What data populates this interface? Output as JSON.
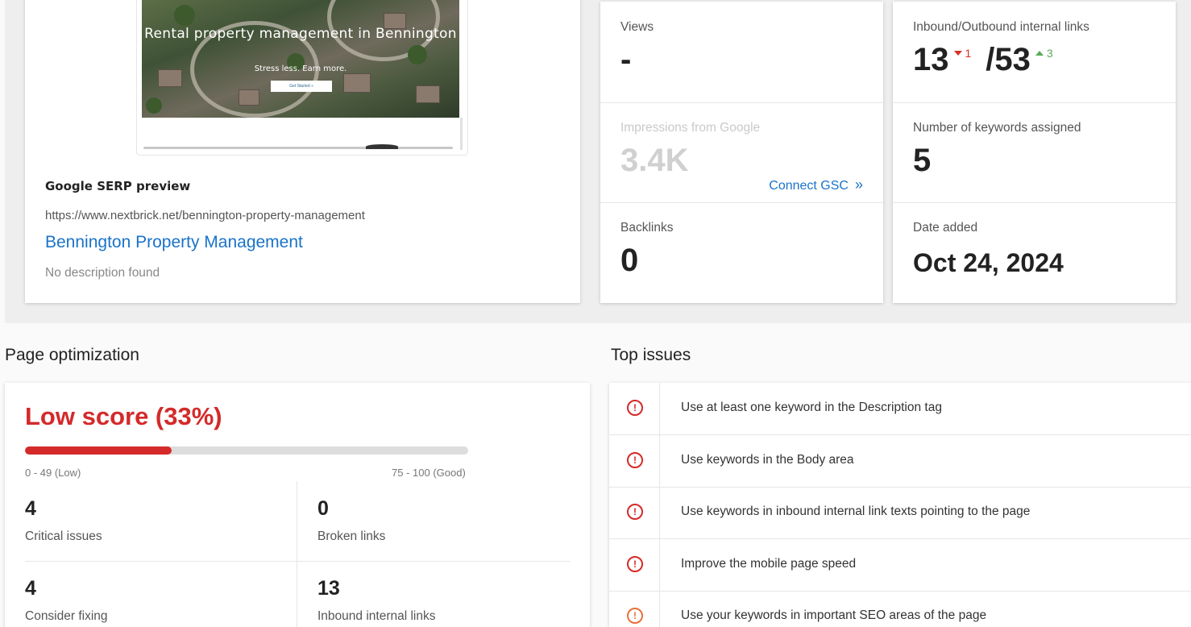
{
  "preview": {
    "thumbnail_title": "Rental property management in Bennington",
    "thumbnail_subtitle": "Stress less. Earn more.",
    "thumbnail_button": "Get Started »",
    "serp_heading": "Google SERP preview",
    "serp_url": "https://www.nextbrick.net/bennington-property-management",
    "serp_title": "Bennington Property Management",
    "serp_description": "No description found"
  },
  "metrics": {
    "views": {
      "label": "Views",
      "value": "-"
    },
    "impressions": {
      "label": "Impressions from Google",
      "value": "3.4K",
      "link": "Connect GSC",
      "link_icon": "»"
    },
    "backlinks": {
      "label": "Backlinks",
      "value": "0"
    },
    "internal_links": {
      "label": "Inbound/Outbound internal links",
      "inbound": "13",
      "inbound_delta": "1",
      "outbound": "/53",
      "outbound_delta": "3"
    },
    "keywords": {
      "label": "Number of keywords assigned",
      "value": "5"
    },
    "date_added": {
      "label": "Date added",
      "value": "Oct 24, 2024"
    }
  },
  "optimization": {
    "section_title": "Page optimization",
    "score_label": "Low score (33%)",
    "score_percent": 33,
    "range_low": "0 - 49 (Low)",
    "range_good": "75 - 100 (Good)",
    "stats": [
      {
        "value": "4",
        "label": "Critical issues"
      },
      {
        "value": "0",
        "label": "Broken links"
      },
      {
        "value": "4",
        "label": "Consider fixing"
      },
      {
        "value": "13",
        "label": "Inbound internal links"
      }
    ]
  },
  "issues": {
    "section_title": "Top issues",
    "items": [
      {
        "text": "Use at least one keyword in the Description tag",
        "severity": "critical"
      },
      {
        "text": "Use keywords in the Body area",
        "severity": "critical"
      },
      {
        "text": "Use keywords in inbound internal link texts pointing to the page",
        "severity": "critical"
      },
      {
        "text": "Improve the mobile page speed",
        "severity": "critical"
      },
      {
        "text": "Use your keywords in important SEO areas of the page",
        "severity": "warning"
      }
    ],
    "icon_glyph": "!"
  },
  "colors": {
    "accent_blue": "#1a73c8",
    "critical_red": "#d42a2a",
    "warning_orange": "#e8703a",
    "delta_up_green": "#5aaa5a"
  }
}
